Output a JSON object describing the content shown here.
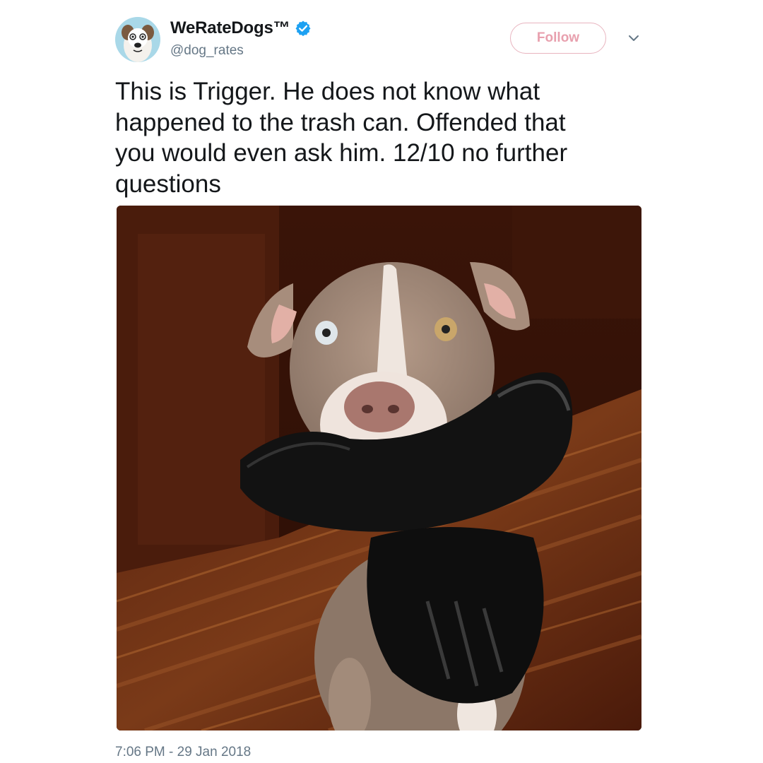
{
  "account": {
    "display_name": "WeRateDogs™",
    "handle": "@dog_rates",
    "verified": true,
    "avatar_icon": "dog-avatar"
  },
  "actions": {
    "follow_label": "Follow",
    "menu_icon": "chevron-down-icon"
  },
  "tweet": {
    "text": "This is Trigger. He does not know what\nhappened to the trash can. Offended that\nyou would even ask him. 12/10 no further\nquestions",
    "media_alt_icon": "photo-dog-with-trash-can",
    "timestamp": "7:06 PM - 29 Jan 2018"
  },
  "colors": {
    "verified_blue": "#1da1f2",
    "follow_border": "#e8b4bf",
    "follow_text": "#e8a0ae",
    "secondary_text": "#657786",
    "primary_text": "#14171a"
  }
}
